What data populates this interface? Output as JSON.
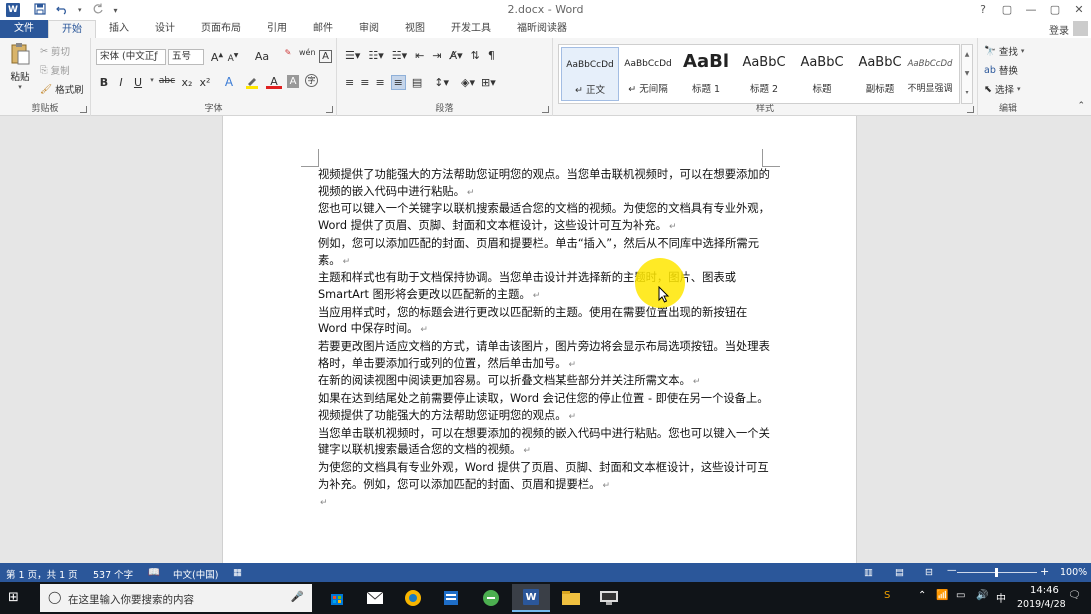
{
  "window": {
    "title": "2.docx - Word",
    "controls": [
      "?",
      "▢",
      "—",
      "▢",
      "✕"
    ]
  },
  "ribbon_tabs": [
    "文件",
    "开始",
    "插入",
    "设计",
    "页面布局",
    "引用",
    "邮件",
    "审阅",
    "视图",
    "开发工具",
    "福昕阅读器"
  ],
  "account": {
    "login": "登录"
  },
  "clipboard": {
    "paste": "粘贴",
    "cut": "剪切",
    "copy": "复制",
    "format_painter": "格式刷",
    "group": "剪贴板"
  },
  "font": {
    "name": "宋体 (中文正ƒ",
    "size": "五号",
    "group": "字体",
    "buttons": [
      "B",
      "I",
      "U",
      "abc",
      "x₂",
      "x²"
    ],
    "grow": "A",
    "shrink": "A",
    "case": "Aa",
    "phonetic": "wén",
    "char_border": "A"
  },
  "paragraph": {
    "group": "段落"
  },
  "styles": {
    "group": "样式",
    "items": [
      {
        "sample": "AaBbCcDd",
        "name": "↵ 正文"
      },
      {
        "sample": "AaBbCcDd",
        "name": "↵ 无间隔"
      },
      {
        "sample": "AaBl",
        "name": "标题 1"
      },
      {
        "sample": "AaBbC",
        "name": "标题 2"
      },
      {
        "sample": "AaBbC",
        "name": "标题"
      },
      {
        "sample": "AaBbC",
        "name": "副标题"
      },
      {
        "sample": "AaBbCcDd",
        "name": "不明显强调"
      }
    ]
  },
  "editing": {
    "find": "查找",
    "replace": "替换",
    "select": "选择",
    "group": "编辑"
  },
  "document": {
    "paragraphs": [
      "视频提供了功能强大的方法帮助您证明您的观点。当您单击联机视频时，可以在想要添加的视频的嵌入代码中进行粘贴。",
      "您也可以键入一个关键字以联机搜索最适合您的文档的视频。为使您的文档具有专业外观，Word 提供了页眉、页脚、封面和文本框设计，这些设计可互为补充。",
      "例如，您可以添加匹配的封面、页眉和提要栏。单击“插入”，然后从不同库中选择所需元素。",
      "主题和样式也有助于文档保持协调。当您单击设计并选择新的主题时，图片、图表或 SmartArt 图形将会更改以匹配新的主题。",
      "当应用样式时，您的标题会进行更改以匹配新的主题。使用在需要位置出现的新按钮在 Word 中保存时间。",
      "若要更改图片适应文档的方式，请单击该图片，图片旁边将会显示布局选项按钮。当处理表格时，单击要添加行或列的位置，然后单击加号。",
      "在新的阅读视图中阅读更加容易。可以折叠文档某些部分并关注所需文本。",
      "如果在达到结尾处之前需要停止读取，Word 会记住您的停止位置 - 即使在另一个设备上。视频提供了功能强大的方法帮助您证明您的观点。",
      "当您单击联机视频时，可以在想要添加的视频的嵌入代码中进行粘贴。您也可以键入一个关键字以联机搜索最适合您的文档的视频。",
      "为使您的文档具有专业外观，Word 提供了页眉、页脚、封面和文本框设计，这些设计可互为补充。例如，您可以添加匹配的封面、页眉和提要栏。",
      ""
    ],
    "para_mark": "↵"
  },
  "statusbar": {
    "page": "第 1 页，共 1 页",
    "words": "537 个字",
    "language": "中文(中国)",
    "zoom": "100%",
    "zoom_level_percent": 100
  },
  "taskbar": {
    "search_placeholder": "在这里输入你要搜索的内容",
    "time": "14:46",
    "date": "2019/4/28"
  },
  "colors": {
    "word_blue": "#2b579a",
    "highlight": "#ffe600"
  }
}
